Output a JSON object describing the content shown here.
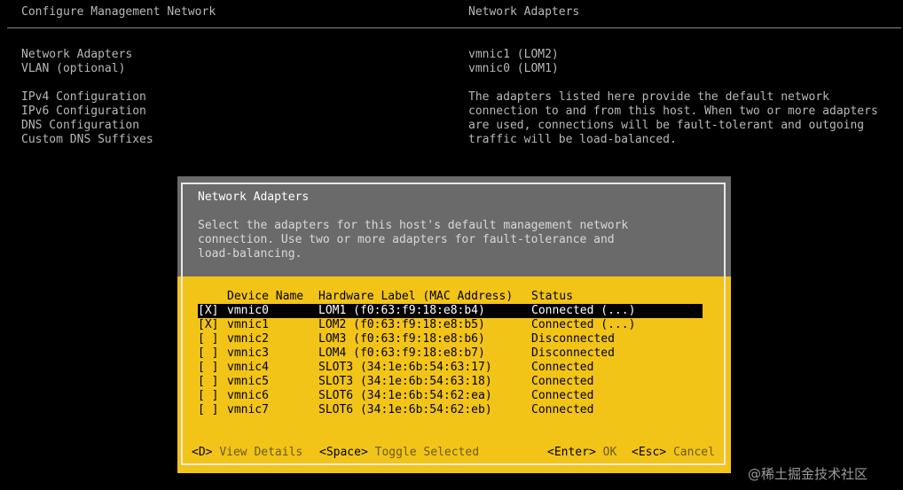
{
  "header": {
    "left_title": "Configure Management Network",
    "right_title": "Network Adapters"
  },
  "menu": {
    "items": [
      "Network Adapters",
      "VLAN (optional)",
      "IPv4 Configuration",
      "IPv6 Configuration",
      "DNS Configuration",
      "Custom DNS Suffixes"
    ]
  },
  "right_panel": {
    "adapters": [
      "vmnic1 (LOM2)",
      "vmnic0 (LOM1)"
    ],
    "description": [
      "The adapters listed here provide the default network",
      "connection to and from this host. When two or more adapters",
      "are used, connections will be fault-tolerant and outgoing",
      "traffic will be load-balanced."
    ]
  },
  "dialog": {
    "title": "Network Adapters",
    "description": [
      "Select the adapters for this host's default management network",
      "connection. Use two or more adapters for fault-tolerance and",
      "load-balancing."
    ],
    "columns": {
      "device": "Device Name",
      "hardware": "Hardware Label (MAC Address)",
      "status": "Status"
    },
    "rows": [
      {
        "check": "[X]",
        "device": "vmnic0",
        "hardware": "LOM1 (f0:63:f9:18:e8:b4)",
        "status": "Connected (...)"
      },
      {
        "check": "[X]",
        "device": "vmnic1",
        "hardware": "LOM2 (f0:63:f9:18:e8:b5)",
        "status": "Connected (...)"
      },
      {
        "check": "[ ]",
        "device": "vmnic2",
        "hardware": "LOM3 (f0:63:f9:18:e8:b6)",
        "status": "Disconnected"
      },
      {
        "check": "[ ]",
        "device": "vmnic3",
        "hardware": "LOM4 (f0:63:f9:18:e8:b7)",
        "status": "Disconnected"
      },
      {
        "check": "[ ]",
        "device": "vmnic4",
        "hardware": "SLOT3 (34:1e:6b:54:63:17)",
        "status": "Connected"
      },
      {
        "check": "[ ]",
        "device": "vmnic5",
        "hardware": "SLOT3 (34:1e:6b:54:63:18)",
        "status": "Connected"
      },
      {
        "check": "[ ]",
        "device": "vmnic6",
        "hardware": "SLOT6 (34:1e:6b:54:62:ea)",
        "status": "Connected"
      },
      {
        "check": "[ ]",
        "device": "vmnic7",
        "hardware": "SLOT6 (34:1e:6b:54:62:eb)",
        "status": "Connected"
      }
    ],
    "footer": {
      "details_key": "<D>",
      "details_label": "View Details",
      "toggle_key": "<Space>",
      "toggle_label": "Toggle Selected",
      "ok_key": "<Enter>",
      "ok_label": "OK",
      "cancel_key": "<Esc>",
      "cancel_label": "Cancel"
    }
  },
  "watermark": "@稀土掘金技术社区",
  "colors": {
    "background": "#000000",
    "dialog_yellow": "#f2c418",
    "dialog_header_gray": "#6a6a6a",
    "text_gray": "#b8b8b8",
    "selected_row": "#000000"
  }
}
